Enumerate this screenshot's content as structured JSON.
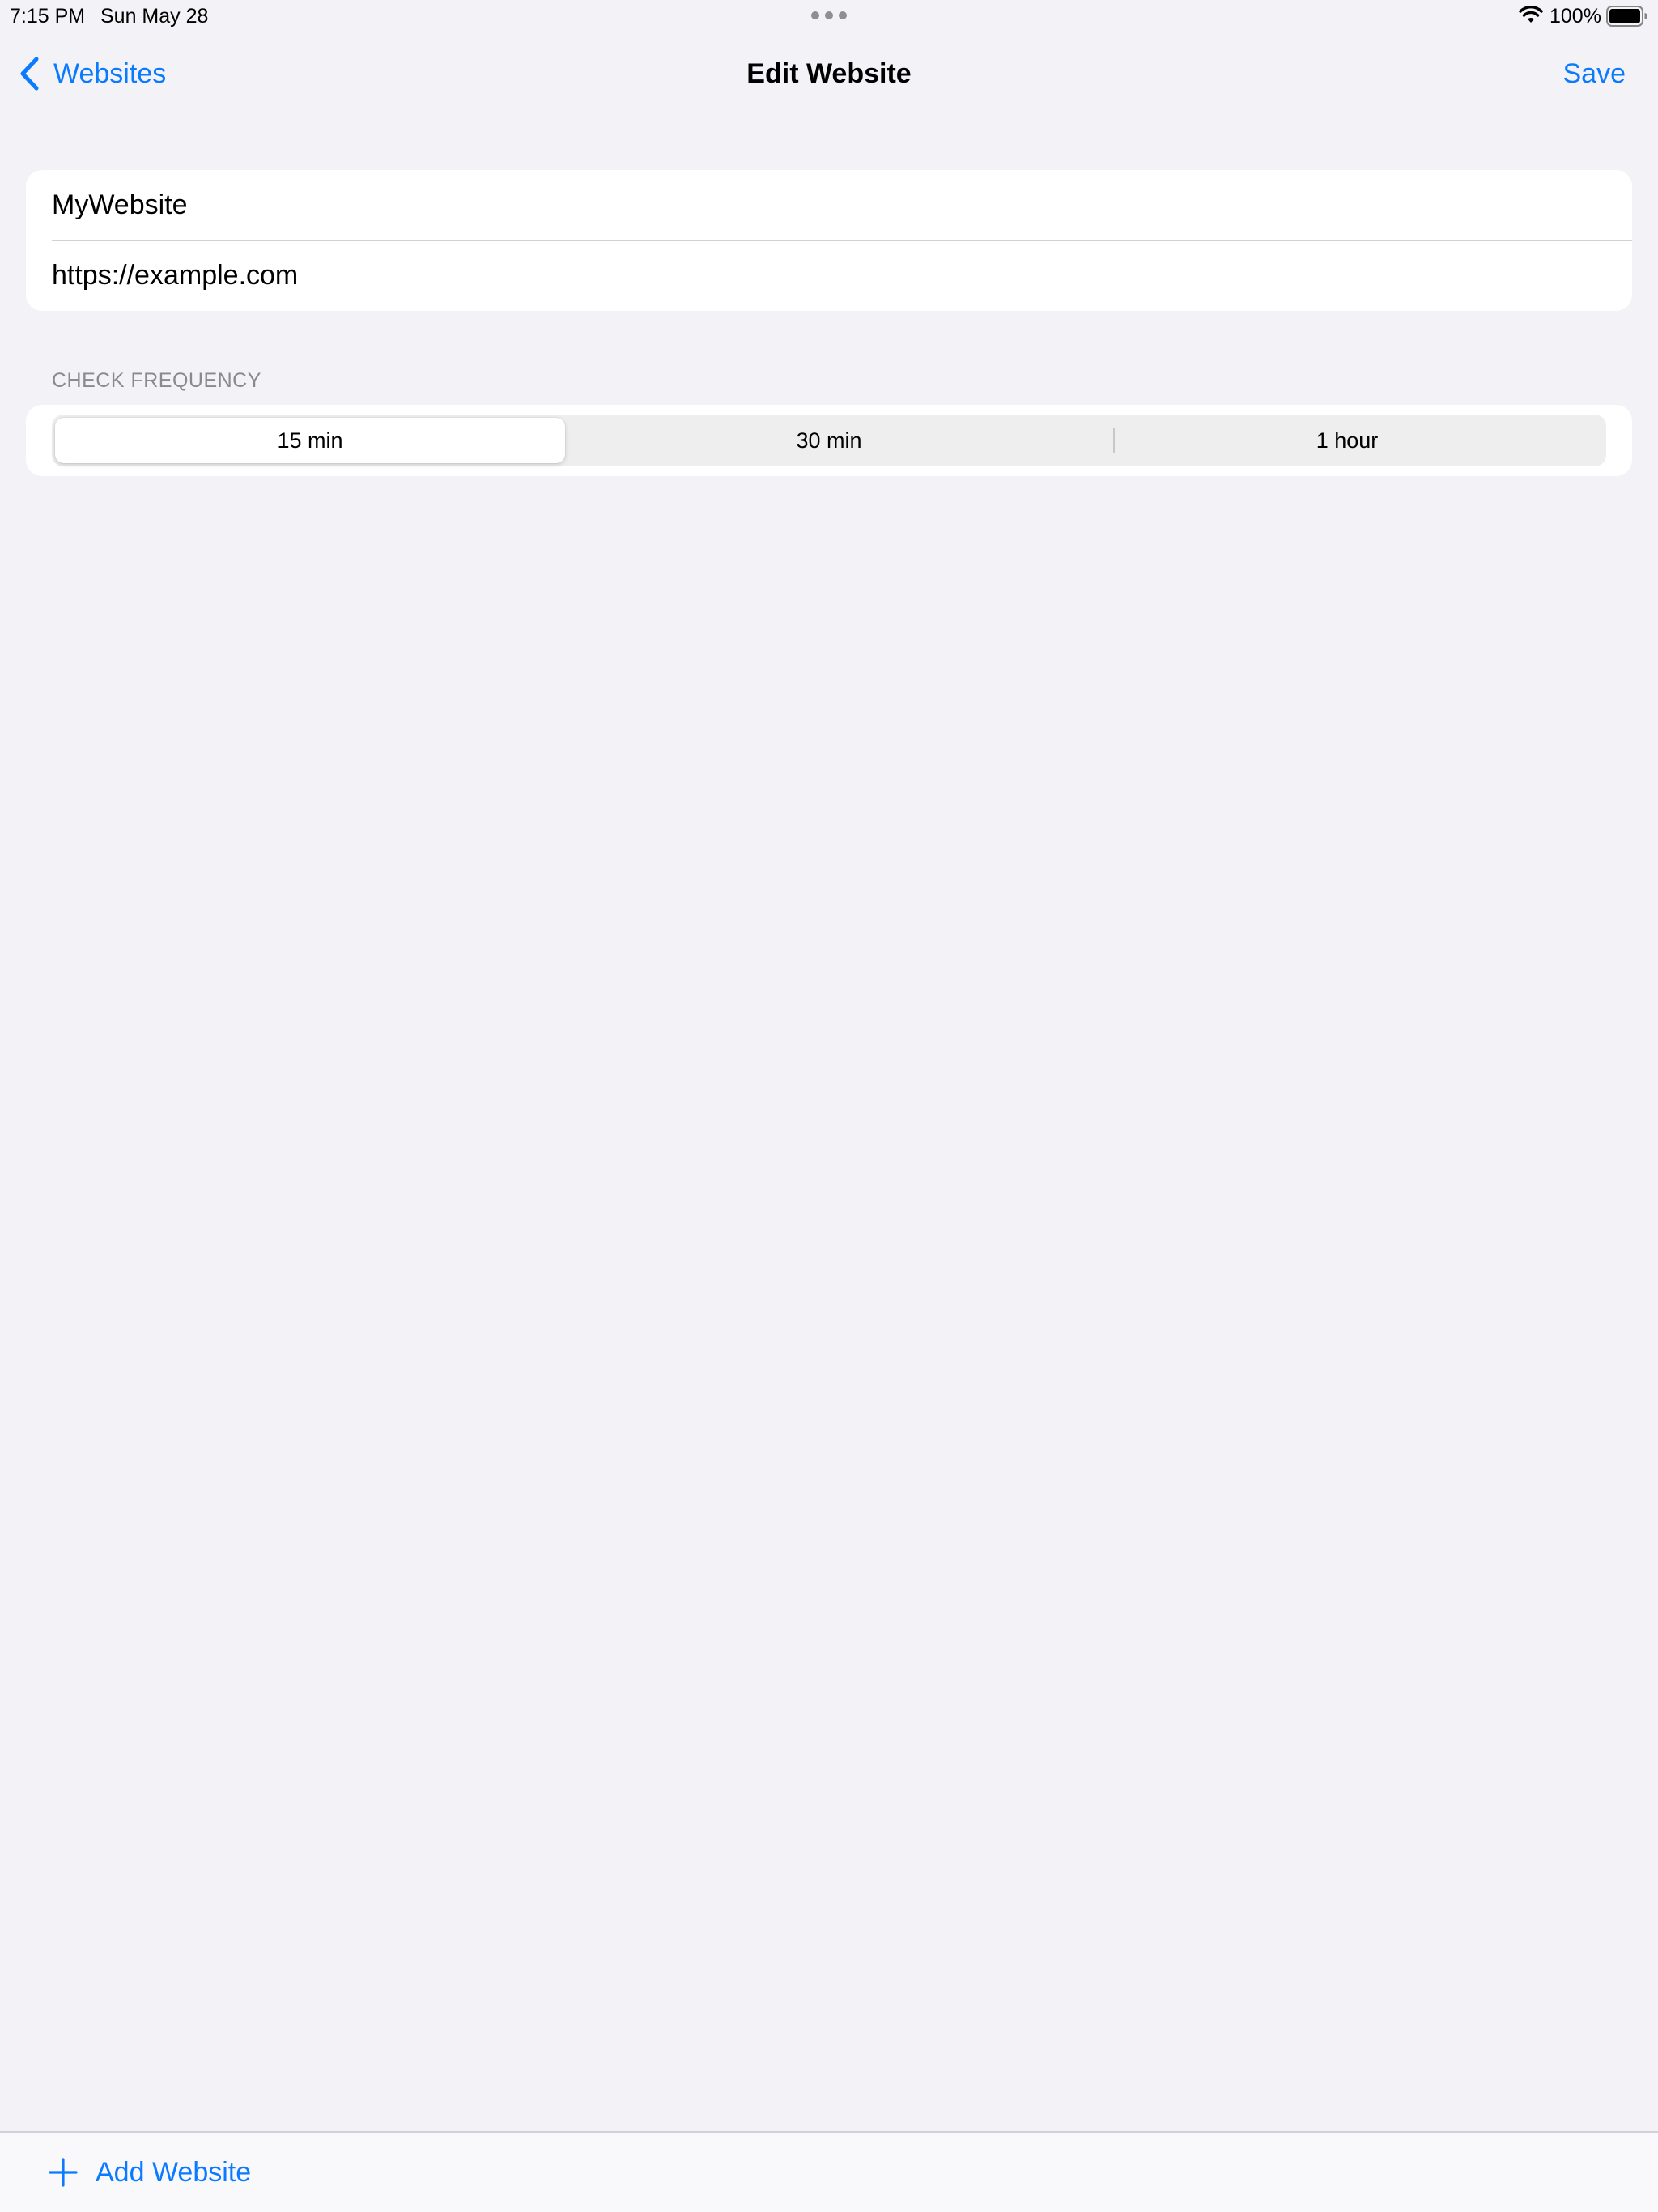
{
  "status_bar": {
    "time": "7:15 PM",
    "date": "Sun May 28",
    "battery": "100%"
  },
  "nav": {
    "back_label": "Websites",
    "title": "Edit Website",
    "save_label": "Save"
  },
  "form": {
    "name_value": "MyWebsite",
    "url_value": "https://example.com"
  },
  "frequency": {
    "header": "CHECK FREQUENCY",
    "options": [
      "15 min",
      "30 min",
      "1 hour"
    ],
    "selected": "15 min"
  },
  "toolbar": {
    "add_label": "Add Website"
  },
  "colors": {
    "accent": "#0a7aff",
    "background": "#f2f2f7",
    "card": "#ffffff",
    "secondary_text": "#8a8a8e"
  },
  "icons": {
    "back": "chevron-left-icon",
    "wifi": "wifi-icon",
    "battery": "battery-icon",
    "add": "plus-icon",
    "multitask": "more-dots-icon"
  }
}
